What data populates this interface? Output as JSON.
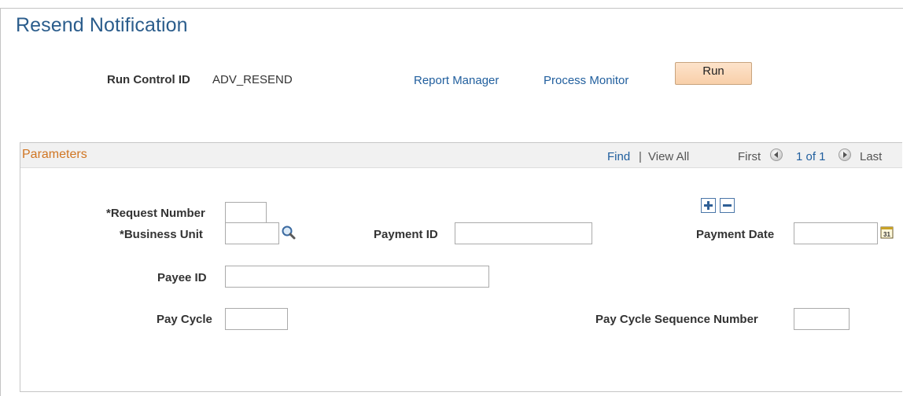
{
  "page": {
    "title": "Resend Notification"
  },
  "run_control": {
    "label": "Run Control ID",
    "value": "ADV_RESEND",
    "report_manager_link": "Report Manager",
    "process_monitor_link": "Process Monitor",
    "run_button": "Run"
  },
  "parameters": {
    "title": "Parameters",
    "nav": {
      "find": "Find",
      "separator": "|",
      "view_all": "View All",
      "first": "First",
      "counter": "1 of 1",
      "last": "Last"
    },
    "icons": {
      "previous": "previous-arrow-icon",
      "next": "next-arrow-icon",
      "add_row": "plus-icon",
      "delete_row": "minus-icon",
      "lookup": "magnifier-icon",
      "calendar": "calendar-icon"
    },
    "fields": {
      "request_number": {
        "label": "*Request Number",
        "value": ""
      },
      "business_unit": {
        "label": "*Business Unit",
        "value": ""
      },
      "payment_id": {
        "label": "Payment ID",
        "value": ""
      },
      "payment_date": {
        "label": "Payment Date",
        "value": ""
      },
      "payee_id": {
        "label": "Payee ID",
        "value": ""
      },
      "pay_cycle": {
        "label": "Pay Cycle",
        "value": ""
      },
      "pay_cycle_sequence_number": {
        "label": "Pay Cycle Sequence Number",
        "value": ""
      }
    }
  },
  "colors": {
    "title": "#2b5d8c",
    "link": "#215f9e",
    "group_title": "#d07522",
    "run_button": "#fbd9ba"
  }
}
